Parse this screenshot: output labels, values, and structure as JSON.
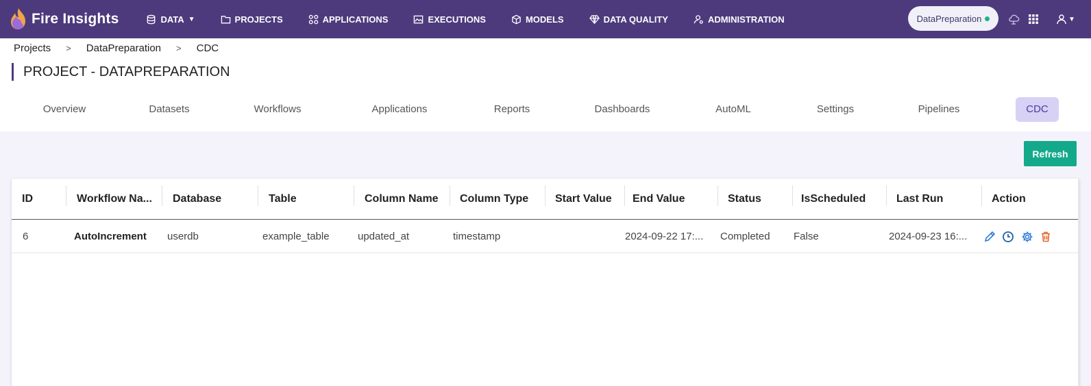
{
  "brand": {
    "name": "Fire Insights"
  },
  "nav": {
    "items": [
      {
        "label": "DATA",
        "icon": "database-icon"
      },
      {
        "label": "PROJECTS",
        "icon": "folder-icon"
      },
      {
        "label": "APPLICATIONS",
        "icon": "apps-grid-icon"
      },
      {
        "label": "EXECUTIONS",
        "icon": "image-chart-icon"
      },
      {
        "label": "MODELS",
        "icon": "cube-icon"
      },
      {
        "label": "DATA QUALITY",
        "icon": "diamond-icon"
      },
      {
        "label": "ADMINISTRATION",
        "icon": "user-settings-icon"
      }
    ],
    "project_pill": "DataPreparation",
    "status_color": "#1cb38a"
  },
  "breadcrumb": [
    "Projects",
    "DataPreparation",
    "CDC"
  ],
  "page_title": "PROJECT - DATAPREPARATION",
  "tabs": [
    "Overview",
    "Datasets",
    "Workflows",
    "Applications",
    "Reports",
    "Dashboards",
    "AutoML",
    "Settings",
    "Pipelines",
    "CDC"
  ],
  "active_tab": "CDC",
  "refresh_label": "Refresh",
  "table": {
    "columns": [
      "ID",
      "Workflow Na...",
      "Database",
      "Table",
      "Column Name",
      "Column Type",
      "Start Value",
      "End Value",
      "Status",
      "IsScheduled",
      "Last Run",
      "Action"
    ],
    "rows": [
      {
        "id": "6",
        "workflow": "AutoIncrement",
        "database": "userdb",
        "table": "example_table",
        "column_name": "updated_at",
        "column_type": "timestamp",
        "start_value": "",
        "end_value": "2024-09-22 17:...",
        "status": "Completed",
        "is_scheduled": "False",
        "last_run": "2024-09-23 16:..."
      }
    ],
    "actions": [
      "edit-icon",
      "clock-icon",
      "settings-gear-icon",
      "trash-icon"
    ]
  },
  "colors": {
    "nav_bg": "#4d3a7d",
    "accent_green": "#14a98b",
    "active_tab_bg": "#d6d1f5",
    "edit": "#2e7bd6",
    "clock": "#1f5fa8",
    "gear": "#2e7bd6",
    "trash": "#e0662a"
  }
}
